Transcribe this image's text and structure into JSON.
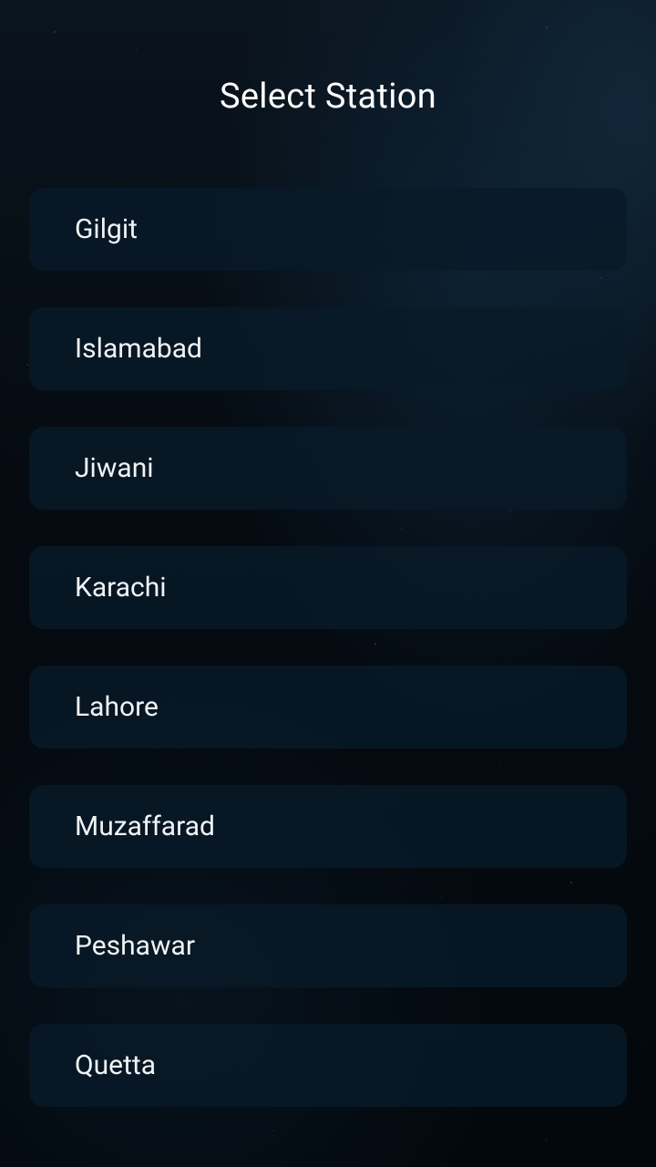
{
  "header": {
    "title": "Select Station"
  },
  "stations": [
    {
      "label": "Gilgit"
    },
    {
      "label": "Islamabad"
    },
    {
      "label": "Jiwani"
    },
    {
      "label": "Karachi"
    },
    {
      "label": "Lahore"
    },
    {
      "label": "Muzaffarad"
    },
    {
      "label": "Peshawar"
    },
    {
      "label": "Quetta"
    }
  ],
  "colors": {
    "background": "#050b11",
    "item_background": "#081a28",
    "text": "#f0f3f5"
  }
}
